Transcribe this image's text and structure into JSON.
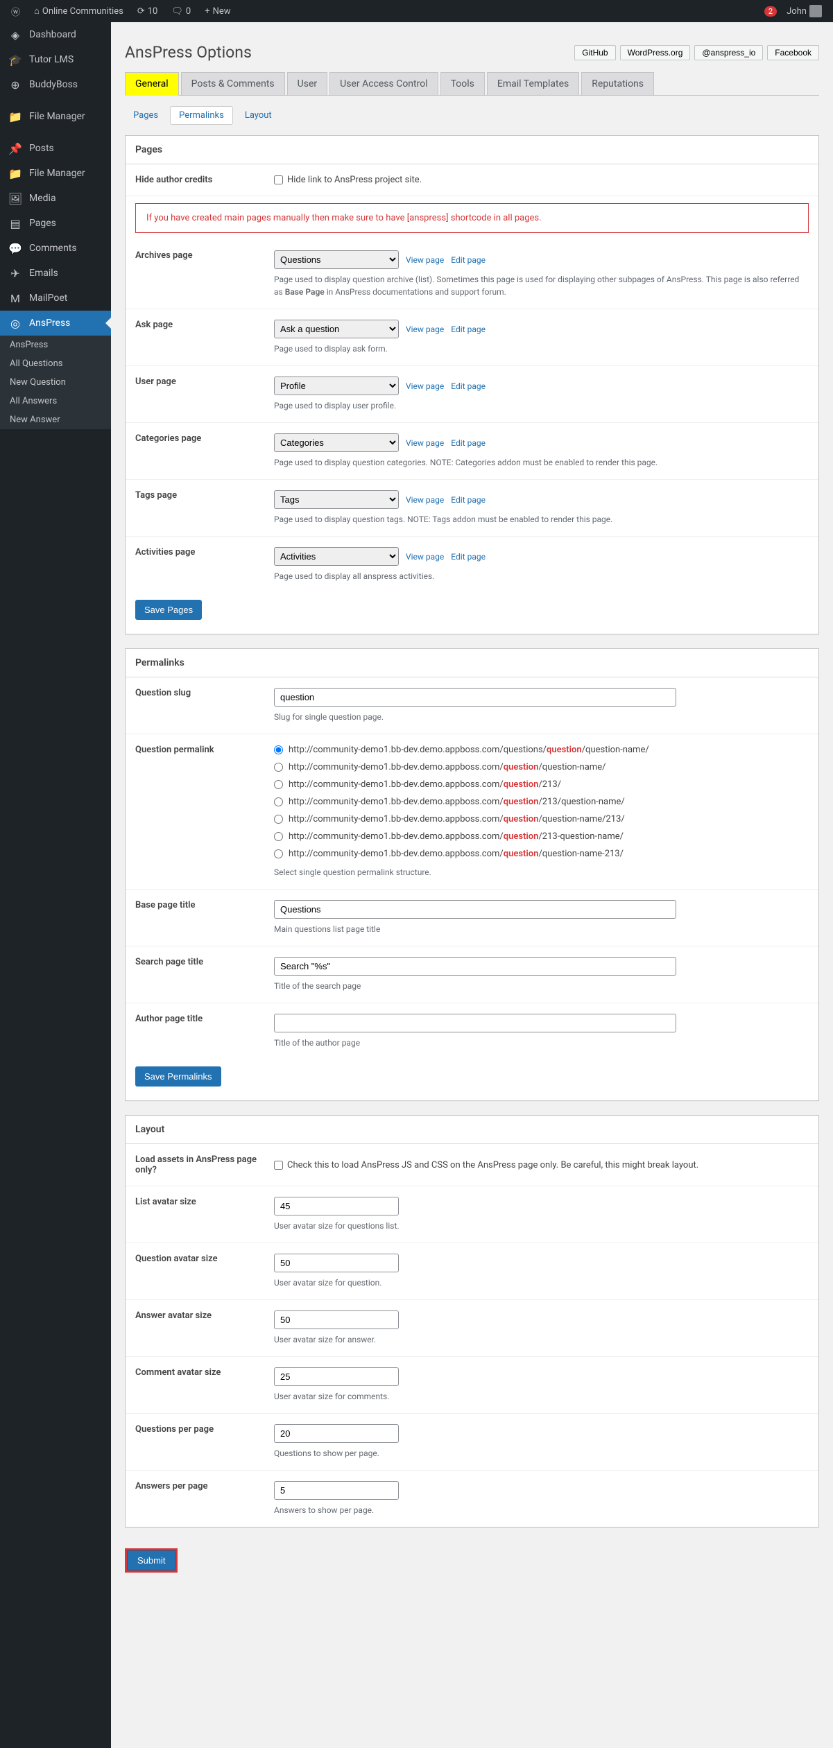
{
  "adminbar": {
    "site": "Online Communities",
    "comments": "0",
    "updates": "10",
    "new": "New",
    "user_name": "John",
    "user_badge": "2"
  },
  "sidebar": {
    "items": [
      {
        "icon": "◈",
        "label": "Dashboard"
      },
      {
        "icon": "🎓",
        "label": "Tutor LMS"
      },
      {
        "icon": "⊕",
        "label": "BuddyBoss"
      },
      {
        "icon": "📁",
        "label": "File Manager"
      },
      {
        "icon": "📌",
        "label": "Posts"
      },
      {
        "icon": "📁",
        "label": "File Manager"
      },
      {
        "icon": "🖼",
        "label": "Media"
      },
      {
        "icon": "▤",
        "label": "Pages"
      },
      {
        "icon": "💬",
        "label": "Comments"
      },
      {
        "icon": "✈",
        "label": "Emails"
      },
      {
        "icon": "M",
        "label": "MailPoet"
      },
      {
        "icon": "◎",
        "label": "AnsPress"
      }
    ],
    "sub": [
      "AnsPress",
      "All Questions",
      "New Question",
      "All Answers",
      "New Answer"
    ]
  },
  "header": {
    "title": "AnsPress Options",
    "links": [
      "GitHub",
      "WordPress.org",
      "@anspress_io",
      "Facebook"
    ]
  },
  "tabs": [
    "General",
    "Posts & Comments",
    "User",
    "User Access Control",
    "Tools",
    "Email Templates",
    "Reputations"
  ],
  "subtabs": [
    "Pages",
    "Permalinks",
    "Layout"
  ],
  "pages_section": {
    "title": "Pages",
    "hide_author": {
      "label": "Hide author credits",
      "cb": "Hide link to AnsPress project site."
    },
    "notice": "If you have created main pages manually then make sure to have [anspress] shortcode in all pages.",
    "archives": {
      "label": "Archives page",
      "value": "Questions",
      "desc_pre": "Page used to display question archive (list). Sometimes this page is used for displaying other subpages of AnsPress. This page is also referred as ",
      "desc_bold": "Base Page",
      "desc_post": " in AnsPress documentations and support forum."
    },
    "ask": {
      "label": "Ask page",
      "value": "Ask a question",
      "desc": "Page used to display ask form."
    },
    "user": {
      "label": "User page",
      "value": "Profile",
      "desc": "Page used to display user profile."
    },
    "categories": {
      "label": "Categories page",
      "value": "Categories",
      "desc": "Page used to display question categories. NOTE: Categories addon must be enabled to render this page."
    },
    "tags": {
      "label": "Tags page",
      "value": "Tags",
      "desc": "Page used to display question tags. NOTE: Tags addon must be enabled to render this page."
    },
    "activities": {
      "label": "Activities page",
      "value": "Activities",
      "desc": "Page used to display all anspress activities."
    },
    "view_page": "View page",
    "edit_page": "Edit page",
    "save": "Save Pages"
  },
  "permalinks_section": {
    "title": "Permalinks",
    "qslug": {
      "label": "Question slug",
      "value": "question",
      "desc": "Slug for single question page."
    },
    "perm": {
      "label": "Question permalink",
      "desc": "Select single question permalink structure.",
      "url_base": "http://community-demo1.bb-dev.demo.appboss.com/",
      "options": [
        {
          "pre": "questions/",
          "slug": "question",
          "post": "/question-name/"
        },
        {
          "pre": "",
          "slug": "question",
          "post": "/question-name/"
        },
        {
          "pre": "",
          "slug": "question",
          "post": "/213/"
        },
        {
          "pre": "",
          "slug": "question",
          "post": "/213/question-name/"
        },
        {
          "pre": "",
          "slug": "question",
          "post": "/question-name/213/"
        },
        {
          "pre": "",
          "slug": "question",
          "post": "/213-question-name/"
        },
        {
          "pre": "",
          "slug": "question",
          "post": "/question-name-213/"
        }
      ]
    },
    "base_title": {
      "label": "Base page title",
      "value": "Questions",
      "desc": "Main questions list page title"
    },
    "search_title": {
      "label": "Search page title",
      "value": "Search \"%s\"",
      "desc": "Title of the search page"
    },
    "author_title": {
      "label": "Author page title",
      "value": "",
      "desc": "Title of the author page"
    },
    "save": "Save Permalinks"
  },
  "layout_section": {
    "title": "Layout",
    "load_assets": {
      "label": "Load assets in AnsPress page only?",
      "cb": "Check this to load AnsPress JS and CSS on the AnsPress page only. Be careful, this might break layout."
    },
    "list_avatar": {
      "label": "List avatar size",
      "value": "45",
      "desc": "User avatar size for questions list."
    },
    "question_avatar": {
      "label": "Question avatar size",
      "value": "50",
      "desc": "User avatar size for question."
    },
    "answer_avatar": {
      "label": "Answer avatar size",
      "value": "50",
      "desc": "User avatar size for answer."
    },
    "comment_avatar": {
      "label": "Comment avatar size",
      "value": "25",
      "desc": "User avatar size for comments."
    },
    "questions_per_page": {
      "label": "Questions per page",
      "value": "20",
      "desc": "Questions to show per page."
    },
    "answers_per_page": {
      "label": "Answers per page",
      "value": "5",
      "desc": "Answers to show per page."
    }
  },
  "submit": "Submit"
}
